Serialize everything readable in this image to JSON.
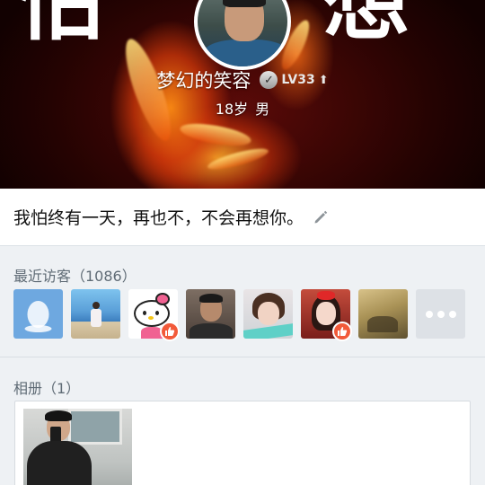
{
  "header": {
    "cover_glyph_left": "怕",
    "cover_glyph_right": "想",
    "nickname": "梦幻的笑容",
    "verify_mark": "✓",
    "level": "LV33",
    "level_arrow": "⬆",
    "age": "18岁",
    "gender": "男"
  },
  "signature": {
    "text": "我怕终有一天，再也不，不会再想你。",
    "edit_icon": "pencil-icon"
  },
  "visitors": {
    "title": "最近访客（1086）",
    "items": [
      {
        "type": "default-penguin",
        "liked": false
      },
      {
        "type": "girl-beach-photo",
        "liked": false
      },
      {
        "type": "hello-kitty",
        "liked": true
      },
      {
        "type": "man-photo",
        "liked": false
      },
      {
        "type": "girl-short-hair-photo",
        "liked": false
      },
      {
        "type": "girl-red-bow-photo",
        "liked": true
      },
      {
        "type": "vintage-scene-photo",
        "liked": false
      },
      {
        "type": "more-tile",
        "liked": false
      }
    ]
  },
  "album": {
    "title": "相册（1）"
  },
  "colors": {
    "like_badge": "#f25a3a",
    "page_bg": "#eef1f4",
    "section_text": "#5f6b75"
  }
}
